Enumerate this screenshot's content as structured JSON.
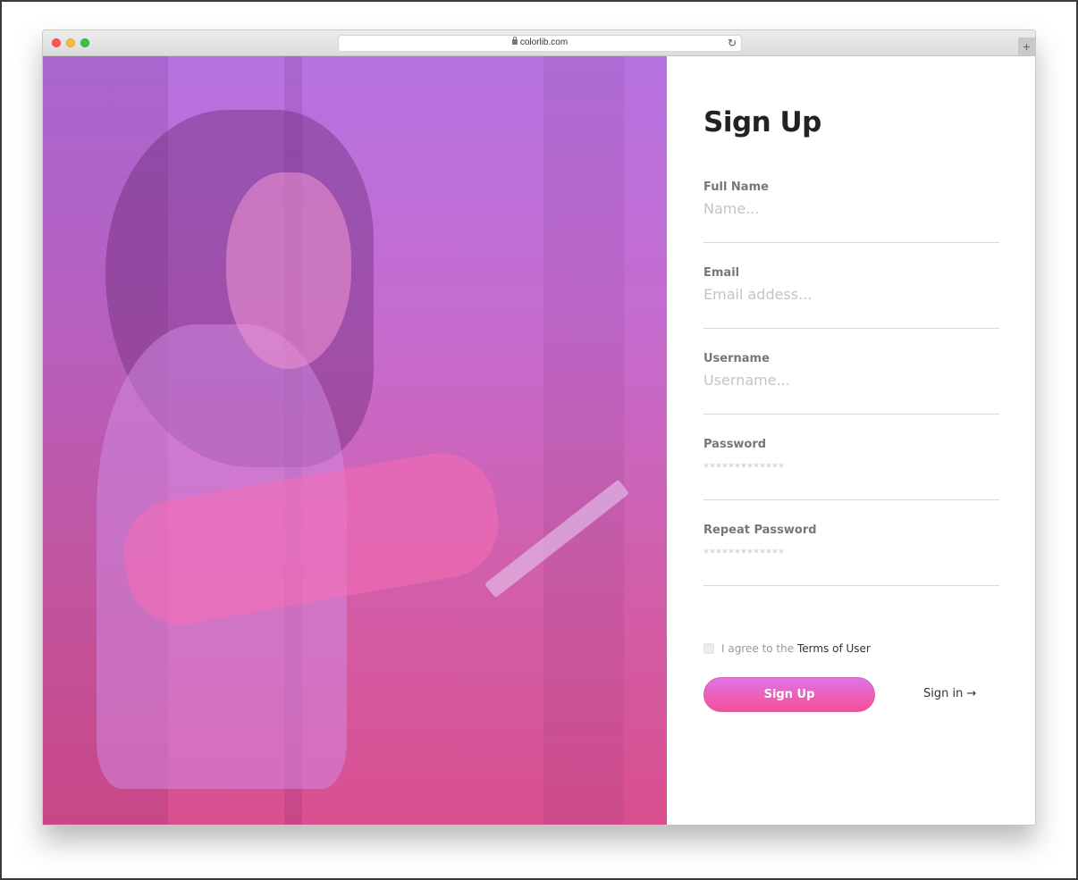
{
  "browser": {
    "url": "colorlib.com",
    "lock_icon": "lock-icon",
    "reload_icon": "reload-icon",
    "reload_glyph": "↻",
    "new_tab_glyph": "+"
  },
  "hero": {
    "image_description": "Woman holding a tablet with purple-to-pink gradient overlay",
    "gradient_top": "#b672e0",
    "gradient_bottom": "#d94f8e"
  },
  "form": {
    "title": "Sign Up",
    "fields": [
      {
        "label": "Full Name",
        "placeholder": "Name...",
        "type": "text"
      },
      {
        "label": "Email",
        "placeholder": "Email addess...",
        "type": "email"
      },
      {
        "label": "Username",
        "placeholder": "Username...",
        "type": "text"
      },
      {
        "label": "Password",
        "placeholder": "*************",
        "type": "password"
      },
      {
        "label": "Repeat Password",
        "placeholder": "*************",
        "type": "password"
      }
    ],
    "agree_prefix": "I agree to the ",
    "terms_link": "Terms of User",
    "agree_checked": false,
    "submit_label": "Sign Up",
    "signin_label": "Sign in",
    "signin_arrow": "→",
    "accent_color": "#ec5fb8"
  }
}
